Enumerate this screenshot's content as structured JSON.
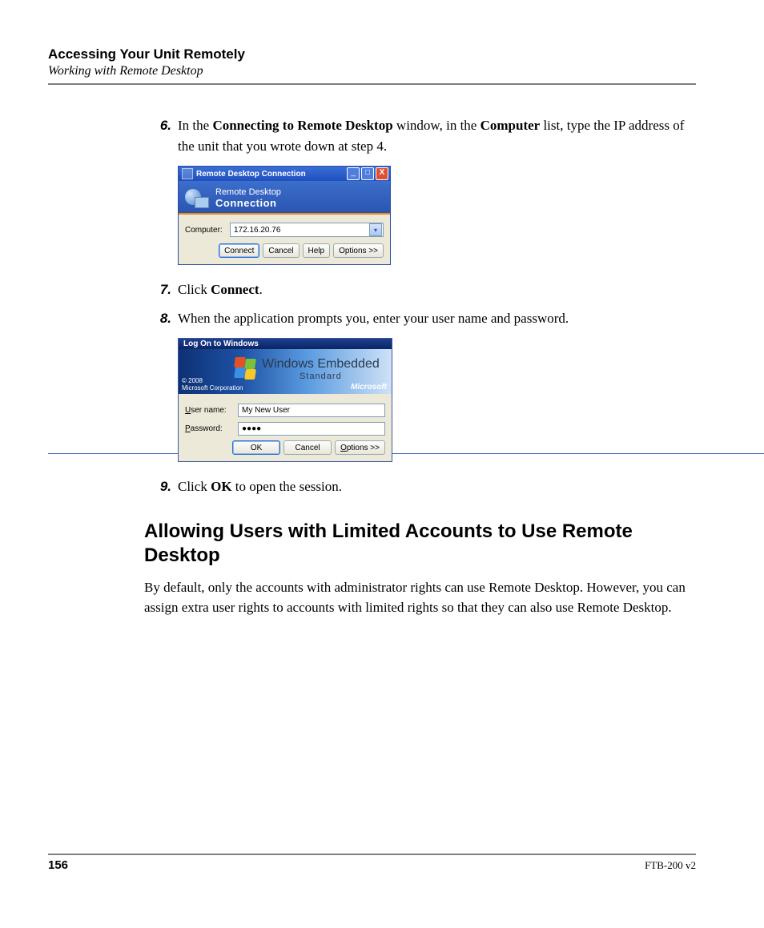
{
  "header": {
    "title": "Accessing Your Unit Remotely",
    "subtitle": "Working with Remote Desktop"
  },
  "steps": {
    "s6": {
      "num": "6.",
      "pre": "In the ",
      "b1": "Connecting to Remote Desktop",
      "mid": " window, in the ",
      "b2": "Computer",
      "post": " list, type the IP address of the unit that you wrote down at step 4."
    },
    "s7": {
      "num": "7.",
      "pre": "Click ",
      "b1": "Connect",
      "post": "."
    },
    "s8": {
      "num": "8.",
      "text": "When the application prompts you, enter your user name and password."
    },
    "s9": {
      "num": "9.",
      "pre": "Click ",
      "b1": "OK",
      "post": " to open the session."
    }
  },
  "rdc": {
    "title": "Remote Desktop Connection",
    "banner_l1": "Remote Desktop",
    "banner_l2": "Connection",
    "label_computer": "Computer:",
    "value_computer": "172.16.20.76",
    "btn_connect": "Connect",
    "btn_cancel": "Cancel",
    "btn_help": "Help",
    "btn_options": "Options >>"
  },
  "logon": {
    "title": "Log On to Windows",
    "product_l1": "Windows Embedded",
    "product_l2": "Standard",
    "copyright_l1": "© 2008",
    "copyright_l2": "Microsoft Corporation",
    "ms": "Microsoft",
    "label_user_pre": "U",
    "label_user_post": "ser name:",
    "label_pass_pre": "P",
    "label_pass_post": "assword:",
    "value_user": "My New User",
    "value_pass": "●●●●",
    "btn_ok": "OK",
    "btn_cancel": "Cancel",
    "btn_options_pre": "O",
    "btn_options_post": "ptions >>"
  },
  "section": {
    "heading": "Allowing Users with Limited Accounts to Use Remote Desktop",
    "para": "By default, only the accounts with administrator rights can use Remote Desktop. However, you can assign extra user rights to accounts with limited rights so that they can also use Remote Desktop."
  },
  "footer": {
    "page": "156",
    "model": "FTB-200 v2"
  }
}
